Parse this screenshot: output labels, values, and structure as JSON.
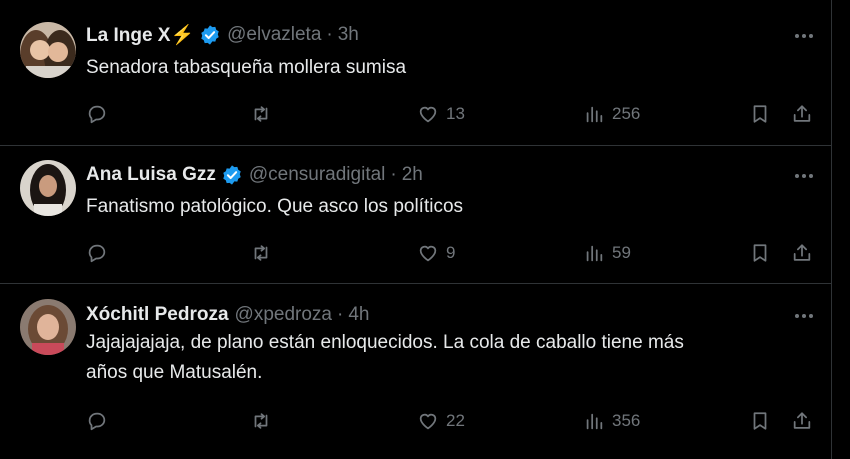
{
  "colors": {
    "background": "#000000",
    "text": "#e7e9ea",
    "muted": "#71767b",
    "verified": "#1d9bf0",
    "border": "#2f3336"
  },
  "tweets": [
    {
      "name": "La Inge X⚡",
      "handle": "@elvazleta",
      "separator": "·",
      "time": "3h",
      "text": "Senadora tabasqueña mollera sumisa",
      "replies": "",
      "retweets": "",
      "likes": "13",
      "views": "256"
    },
    {
      "name": "Ana Luisa Gzz",
      "handle": "@censuradigital",
      "separator": "·",
      "time": "2h",
      "text": "Fanatismo patológico. Que asco los políticos",
      "replies": "",
      "retweets": "",
      "likes": "9",
      "views": "59"
    },
    {
      "name": "Xóchitl Pedroza",
      "handle": "@xpedroza",
      "separator": "·",
      "time": "4h",
      "text_lines": [
        "Jajajajajaja, de plano están enloquecidos. La cola de caballo tiene más",
        "años que Matusalén."
      ],
      "replies": "",
      "retweets": "",
      "likes": "22",
      "views": "356"
    }
  ],
  "icons": [
    "more-icon",
    "reply-icon",
    "retweet-icon",
    "like-icon",
    "views-icon",
    "bookmark-icon",
    "share-icon",
    "verified-badge-icon"
  ]
}
